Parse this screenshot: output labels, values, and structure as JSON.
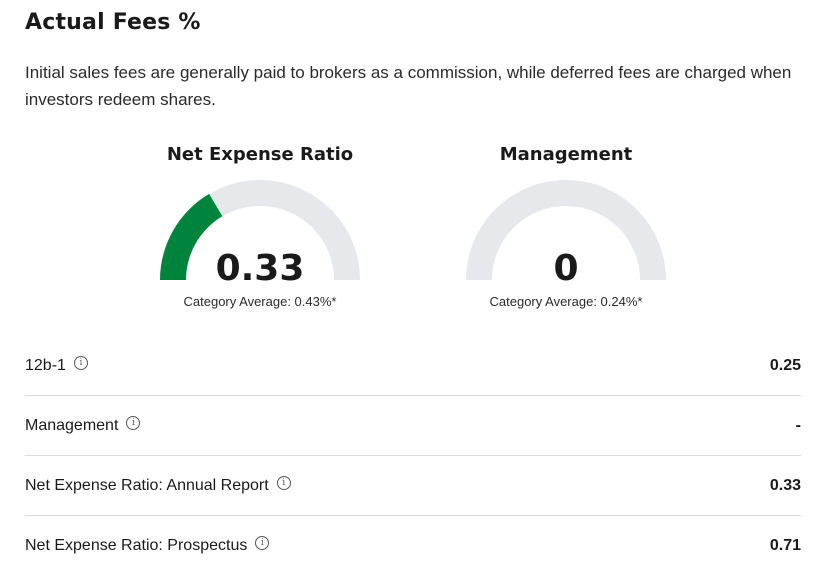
{
  "header": {
    "title": "Actual Fees %",
    "description": "Initial sales fees are generally paid to brokers as a commission, while deferred fees are charged when investors redeem shares."
  },
  "gauges": [
    {
      "title": "Net Expense Ratio",
      "value": "0.33",
      "fill_fraction": 0.33,
      "category_average": "Category Average: 0.43%*",
      "fill_color": "#00843d"
    },
    {
      "title": "Management",
      "value": "0",
      "fill_fraction": 0,
      "category_average": "Category Average: 0.24%*",
      "fill_color": "#00843d"
    }
  ],
  "colors": {
    "track": "#e6e8eb",
    "fill": "#00843d",
    "divider": "#dcdcdc"
  },
  "fee_rows": [
    {
      "label": "12b-1",
      "value": "0.25",
      "icon": "info-icon"
    },
    {
      "label": "Management",
      "value": "-",
      "icon": "info-icon"
    },
    {
      "label": "Net Expense Ratio: Annual Report",
      "value": "0.33",
      "icon": "info-icon"
    },
    {
      "label": "Net Expense Ratio: Prospectus",
      "value": "0.71",
      "icon": "info-icon"
    }
  ]
}
